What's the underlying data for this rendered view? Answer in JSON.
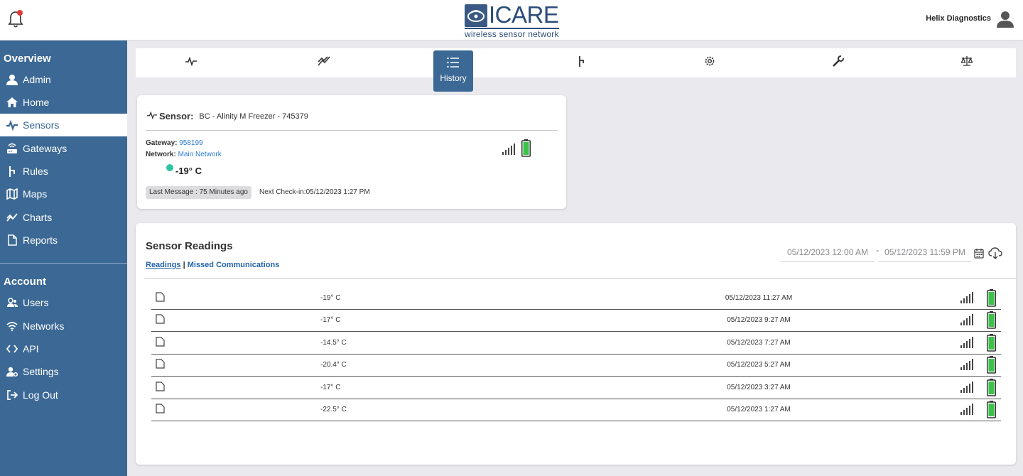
{
  "header": {
    "logo_text": "ICARE",
    "logo_subtitle": "wireless sensor network",
    "org_name": "Helix Diagnostics"
  },
  "sidebar": {
    "overview_title": "Overview",
    "overview_items": [
      {
        "label": "Admin",
        "icon": "user-icon"
      },
      {
        "label": "Home",
        "icon": "home-icon"
      },
      {
        "label": "Sensors",
        "icon": "pulse-icon",
        "active": true
      },
      {
        "label": "Gateways",
        "icon": "router-icon"
      },
      {
        "label": "Rules",
        "icon": "branch-icon"
      },
      {
        "label": "Maps",
        "icon": "map-icon"
      },
      {
        "label": "Charts",
        "icon": "chart-icon"
      },
      {
        "label": "Reports",
        "icon": "document-icon"
      }
    ],
    "account_title": "Account",
    "account_items": [
      {
        "label": "Users",
        "icon": "users-icon"
      },
      {
        "label": "Networks",
        "icon": "wifi-icon"
      },
      {
        "label": "API",
        "icon": "code-icon"
      },
      {
        "label": "Settings",
        "icon": "user-gear-icon"
      },
      {
        "label": "Log Out",
        "icon": "logout-icon"
      }
    ]
  },
  "toolbar": {
    "active_label": "History",
    "icons": [
      "pulse-icon",
      "trend-icon",
      "history-list-icon",
      "branch-icon",
      "gear-icon",
      "wrench-icon",
      "scale-icon"
    ]
  },
  "sensor": {
    "label": "Sensor:",
    "name": "BC - Alinity M Freezer - 745379",
    "gateway_label": "Gateway:",
    "gateway_value": "958199",
    "network_label": "Network:",
    "network_value": "Main Network",
    "temperature": "-19° C",
    "last_message": "Last Message : 75 Minutes ago",
    "next_checkin": "Next Check-in:05/12/2023 1:27 PM",
    "status_color": "#2ec4a0"
  },
  "readings": {
    "title": "Sensor Readings",
    "tab_readings": "Readings",
    "tab_separator": "|",
    "tab_missed": "Missed Communications",
    "date_start": "05/12/2023 12:00 AM",
    "date_separator": "-",
    "date_end": "05/12/2023 11:59 PM",
    "rows": [
      {
        "temp": "-19° C",
        "date": "05/12/2023 11:27 AM"
      },
      {
        "temp": "-17° C",
        "date": "05/12/2023 9:27 AM"
      },
      {
        "temp": "-14.5° C",
        "date": "05/12/2023 7:27 AM"
      },
      {
        "temp": "-20.4° C",
        "date": "05/12/2023 5:27 AM"
      },
      {
        "temp": "-17° C",
        "date": "05/12/2023 3:27 AM"
      },
      {
        "temp": "-22.5° C",
        "date": "05/12/2023 1:27 AM"
      }
    ]
  },
  "colors": {
    "sidebar": "#3b6894",
    "battery": "#3cc24a",
    "link": "#2563a8",
    "notification_dot": "#e53935"
  }
}
